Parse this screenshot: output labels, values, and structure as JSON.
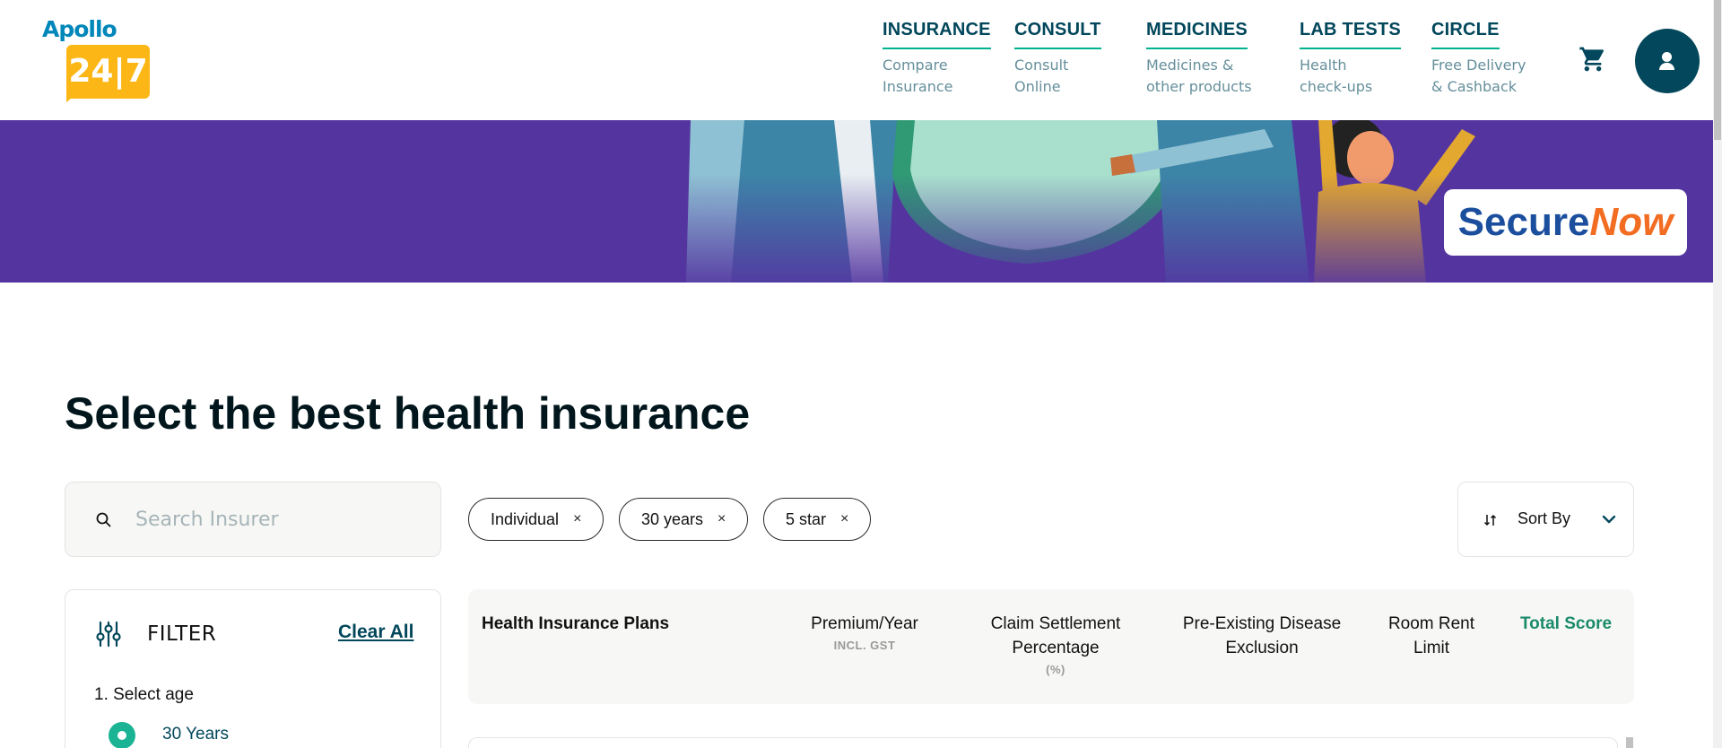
{
  "brand": {
    "logo_text": "Apollo",
    "logo_badge": "24|7"
  },
  "nav": [
    {
      "title": "INSURANCE",
      "sub": "Compare\nInsurance"
    },
    {
      "title": "CONSULT",
      "sub": "Consult\nOnline"
    },
    {
      "title": "MEDICINES",
      "sub": "Medicines &\nother products"
    },
    {
      "title": "LAB TESTS",
      "sub": "Health\ncheck-ups"
    },
    {
      "title": "CIRCLE",
      "sub": "Free Delivery\n& Cashback"
    }
  ],
  "icons": {
    "cart": "cart-icon",
    "profile": "user-icon",
    "search": "search-icon",
    "sort": "sort-icon",
    "sort_chevron": "chevron-down-icon",
    "filter": "sliders-icon",
    "chip_remove": "close-icon"
  },
  "banner": {
    "partner_part1": "Secure",
    "partner_part2": "Now",
    "background_color": "#5435a0"
  },
  "page_title": "Select the best health insurance",
  "search": {
    "placeholder": "Search Insurer",
    "value": ""
  },
  "chips": [
    {
      "label": "Individual",
      "remove": "×"
    },
    {
      "label": "30 years",
      "remove": "×"
    },
    {
      "label": "5 star",
      "remove": "×"
    }
  ],
  "sort": {
    "label": "Sort By"
  },
  "filter": {
    "title": "FILTER",
    "clear_label": "Clear All",
    "age_heading": "1. Select age",
    "age_selected": "30 Years"
  },
  "table": {
    "headers": [
      {
        "label": "Health Insurance Plans",
        "sub": ""
      },
      {
        "label": "Premium/Year",
        "sub": "INCL. GST"
      },
      {
        "label": "Claim Settlement Percentage",
        "sub": "(%)"
      },
      {
        "label": "Pre-Existing Disease Exclusion",
        "sub": ""
      },
      {
        "label": "Room Rent Limit",
        "sub": ""
      },
      {
        "label": "Total Score",
        "sub": ""
      }
    ]
  },
  "colors": {
    "primary": "#02475b",
    "accent": "#00b38e",
    "logo_yellow": "#fcb716",
    "score_green": "#1a8a6a"
  }
}
